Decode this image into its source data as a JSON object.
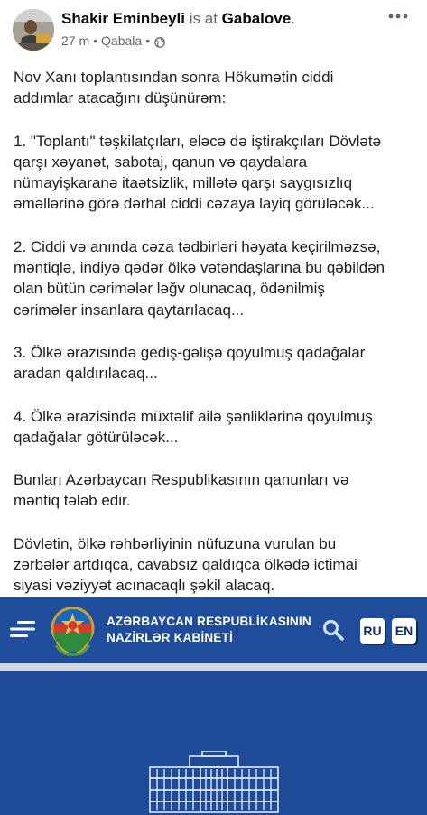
{
  "post": {
    "author": "Shakir Eminbeyli",
    "is_at": "is at",
    "place": "Gabalove",
    "period": ".",
    "time": "27 m",
    "location": "Qabala",
    "privacy_icon": "globe-icon",
    "more_icon": "more-horizontal-icon",
    "paragraphs": [
      "Nov Xanı toplantısından sonra Hökumətin ciddi\naddımlar atacağını düşünürəm:",
      "1. \"Toplantı\" təşkilatçıları, eləcə də iştirakçıları Dövlətə\nqarşı xəyanət, sabotaj, qanun və qaydalara\nnümayişkaranə itaətsizlik, millətə qarşı saygısızlıq\nəməllərinə görə dərhal ciddi cəzaya layiq görüləcək...",
      "2. Ciddi və anında cəza tədbirləri həyata keçirilməzsə,\nməntiqlə, indiyə qədər ölkə vətəndaşlarına bu qəbildən\nolan bütün cərimələr ləğv olunacaq, ödənilmiş\ncərimələr insanlara qaytarılacaq...",
      "3. Ölkə ərazisində gediş-gəlişə qoyulmuş qadağalar\naradan qaldırılacaq...",
      "4. Ölkə ərazisində müxtəlif ailə şənliklərinə qoyulmuş\nqadağalar götürüləcək...",
      "Bunları Azərbaycan Respublikasının qanunları və\nməntiq tələb edir.",
      "Dövlətin, ölkə rəhbərliyinin nüfuzuna vurulan bu\nzərbələr artdıqca, cavabsız qaldıqca ölkədə ictimai\nsiyasi vəziyyət acınacaqlı şəkil alacaq."
    ]
  },
  "shared_image": {
    "site_title_line1": "AZƏRBAYCAN RESPUBLİKASININ",
    "site_title_line2": "NAZİRLƏR KABİNETİ",
    "lang_ru": "RU",
    "lang_en": "EN",
    "menu_icon": "hamburger-menu-icon",
    "search_icon": "search-icon",
    "emblem_icon": "azerbaijan-emblem-icon",
    "building_icon": "government-building-icon",
    "colors": {
      "header_blue": "#1f4d9b",
      "stripe_gray": "#d4d7dd",
      "background_blue": "#1e4b99"
    }
  }
}
